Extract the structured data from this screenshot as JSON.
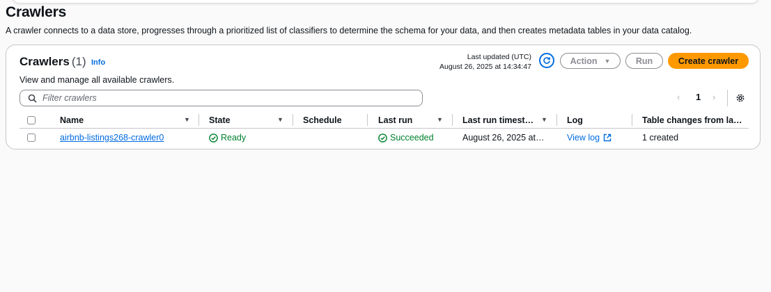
{
  "page": {
    "title": "Crawlers",
    "description": "A crawler connects to a data store, progresses through a prioritized list of classifiers to determine the schema for your data, and then creates metadata tables in your data catalog."
  },
  "panel": {
    "title": "Crawlers",
    "count": "(1)",
    "info": "Info",
    "description": "View and manage all available crawlers.",
    "last_updated_label": "Last updated (UTC)",
    "last_updated_value": "August 26, 2025 at 14:34:47",
    "buttons": {
      "action": "Action",
      "run": "Run",
      "create": "Create crawler"
    },
    "filter_placeholder": "Filter crawlers",
    "pagination": {
      "page": "1"
    }
  },
  "table": {
    "columns": [
      "Name",
      "State",
      "Schedule",
      "Last run",
      "Last run timest…",
      "Log",
      "Table changes from la…"
    ],
    "rows": [
      {
        "name": "airbnb-listings268-crawler0",
        "state": "Ready",
        "schedule": "",
        "last_run": "Succeeded",
        "last_run_timestamp": "August 26, 2025 at…",
        "log": "View log",
        "table_changes": "1 created"
      }
    ]
  },
  "colors": {
    "accent": "#006ce0",
    "primary_button": "#ff9900",
    "success": "#00802f"
  }
}
